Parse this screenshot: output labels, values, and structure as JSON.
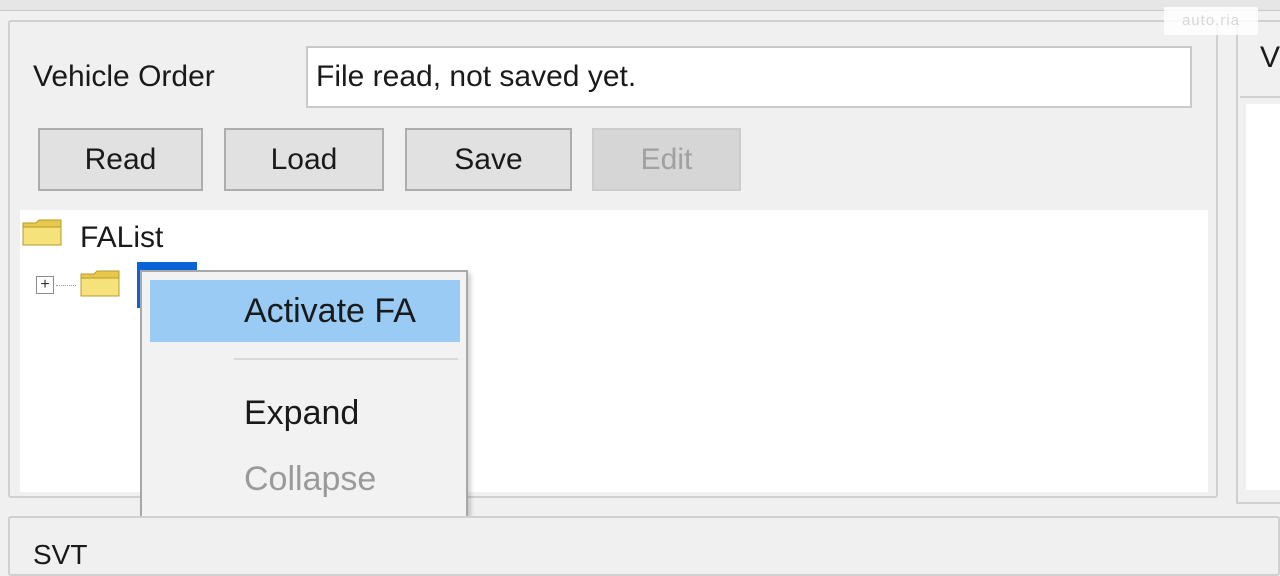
{
  "vehicle_order": {
    "label": "Vehicle Order",
    "status_value": "File read, not saved yet."
  },
  "toolbar": {
    "read_label": "Read",
    "load_label": "Load",
    "save_label": "Save",
    "edit_label": "Edit"
  },
  "tree": {
    "root_label": "FAList",
    "expander_symbol": "+",
    "icons": [
      "folder-icon",
      "expand-icon"
    ]
  },
  "context_menu": {
    "items": [
      {
        "label": "Activate FA",
        "state": "highlighted"
      },
      {
        "label": "Expand",
        "state": "enabled"
      },
      {
        "label": "Collapse",
        "state": "disabled"
      }
    ]
  },
  "right_panel": {
    "header_partial": "V"
  },
  "bottom_panel": {
    "label": "SVT"
  },
  "watermark": {
    "text": "auto.ria"
  },
  "colors": {
    "selection": "#0a64d8",
    "menu_highlight": "#99cbf5",
    "folder": "#f5e27a"
  }
}
